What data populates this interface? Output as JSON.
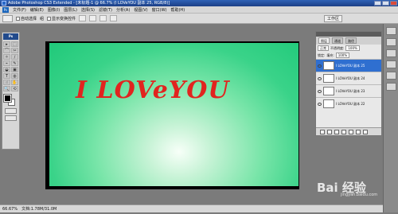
{
  "window": {
    "title": "Adobe Photoshop CS3 Extended - [未标题-1 @ 66.7% (I LOVeYOU 副本 25, RGB/8)]"
  },
  "menu": [
    "文件(F)",
    "编辑(E)",
    "图像(I)",
    "图层(L)",
    "选择(S)",
    "滤镜(T)",
    "分析(A)",
    "视图(V)",
    "窗口(W)",
    "帮助(H)"
  ],
  "options": {
    "auto_select": "自动选择",
    "layer_mode": "组",
    "show_transform": "显示变换控件",
    "workspace": "工作区"
  },
  "toolbox": {
    "badge": "Ps",
    "tools": [
      "▸",
      "⬚",
      "⌒",
      "✂",
      "✧",
      "∕",
      "⌁",
      "✎",
      "◒",
      "▣",
      "T",
      "◍",
      "☝",
      "✋",
      "🔍",
      "⟲"
    ]
  },
  "artwork": {
    "text": "I LOVeYOU",
    "text_color": "#e1241f"
  },
  "layers_panel": {
    "tabs": [
      "图层",
      "通道",
      "路径"
    ],
    "blend_mode": "正常",
    "opacity_label": "不透明度:",
    "opacity_value": "100%",
    "lock_label": "锁定:",
    "fill_label": "填充:",
    "fill_value": "100%",
    "layers": [
      "I LOVeYOU 副本 25",
      "I LOVeYOU 副本 24",
      "I LOVeYOU 副本 23",
      "I LOVeYOU 副本 22"
    ]
  },
  "statusbar": {
    "zoom": "66.67%",
    "doc": "文档:1.78M/31.0M"
  },
  "watermark": {
    "brand": "Bai 经验",
    "sub": "jingyan.baidu.com"
  }
}
